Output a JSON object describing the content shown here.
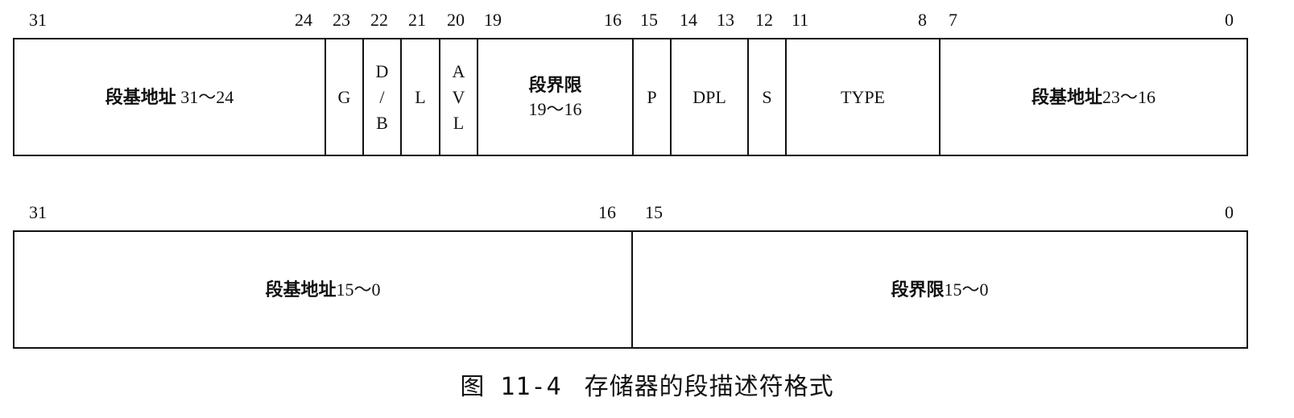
{
  "row1_bits": {
    "b31": "31",
    "b24": "24",
    "b23": "23",
    "b22": "22",
    "b21": "21",
    "b20": "20",
    "b19": "19",
    "b16": "16",
    "b15": "15",
    "b14": "14",
    "b13": "13",
    "b12": "12",
    "b11": "11",
    "b8": "8",
    "b7": "7",
    "b0": "0"
  },
  "row1_fields": {
    "base_31_24_name": "段基地址",
    "base_31_24_range": "31～24",
    "g": "G",
    "db_d": "D",
    "db_slash": "/",
    "db_b": "B",
    "l": "L",
    "avl_a": "A",
    "avl_v": "V",
    "avl_l": "L",
    "limit_19_16_name": "段界限",
    "limit_19_16_range": "19～16",
    "p": "P",
    "dpl": "DPL",
    "s": "S",
    "type": "TYPE",
    "base_23_16_name": "段基地址",
    "base_23_16_range": "23～16"
  },
  "row2_bits": {
    "b31": "31",
    "b16": "16",
    "b15": "15",
    "b0": "0"
  },
  "row2_fields": {
    "base_15_0_name": "段基地址",
    "base_15_0_range": "15～0",
    "limit_15_0_name": "段界限",
    "limit_15_0_range": "15～0"
  },
  "caption": {
    "number": "图 11-4",
    "title": "存储器的段描述符格式"
  }
}
